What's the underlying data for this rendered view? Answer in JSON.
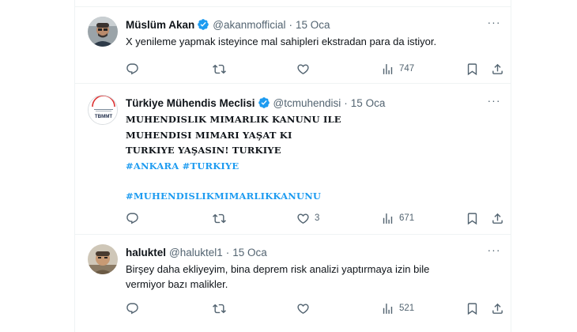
{
  "tweets": [
    {
      "name": "Müslüm Akan",
      "verified": true,
      "handle": "@akanmofficial",
      "dot": "·",
      "date": "15 Oca",
      "text_lines": [
        "X yenileme yapmak isteyince mal sahipleri ekstradan para da istiyor."
      ],
      "replies": "",
      "retweets": "",
      "likes": "",
      "views": "747"
    },
    {
      "name": "Türkiye Mühendis Meclisi",
      "verified": true,
      "handle": "@tcmuhendisi",
      "dot": "·",
      "date": "15 Oca",
      "avatar_text": "TBMMT",
      "text_lines": [
        "MUHENDISLIK MIMARLIK KANUNU ILE",
        "MUHENDISI MIMARI YAŞAT KI",
        "TURKIYE YAŞASIN! TURKIYE"
      ],
      "hashtags_line1": [
        "#ANKARA",
        "#TURKIYE"
      ],
      "hashtags_line2": [
        "#MUHENDISLIKMIMARLIKKANUNU"
      ],
      "replies": "",
      "retweets": "",
      "likes": "3",
      "views": "671"
    },
    {
      "name": "haluktel",
      "verified": false,
      "handle": "@haluktel1",
      "dot": "·",
      "date": "15 Oca",
      "text_lines": [
        "Birşey daha ekliyeyim, bina deprem risk analizi yaptırmaya izin bile",
        "vermiyor bazı malikler."
      ],
      "replies": "",
      "retweets": "",
      "likes": "",
      "views": "521"
    }
  ],
  "icons": {
    "reply": "reply-icon",
    "retweet": "retweet-icon",
    "like": "heart-icon",
    "views": "views-chart-icon",
    "bookmark": "bookmark-icon",
    "share": "share-icon",
    "more": "more-icon",
    "verified": "verified-badge-icon"
  },
  "colors": {
    "text": "#0f1419",
    "secondary": "#536471",
    "link": "#1d9bf0",
    "divider": "#eff3f4"
  }
}
